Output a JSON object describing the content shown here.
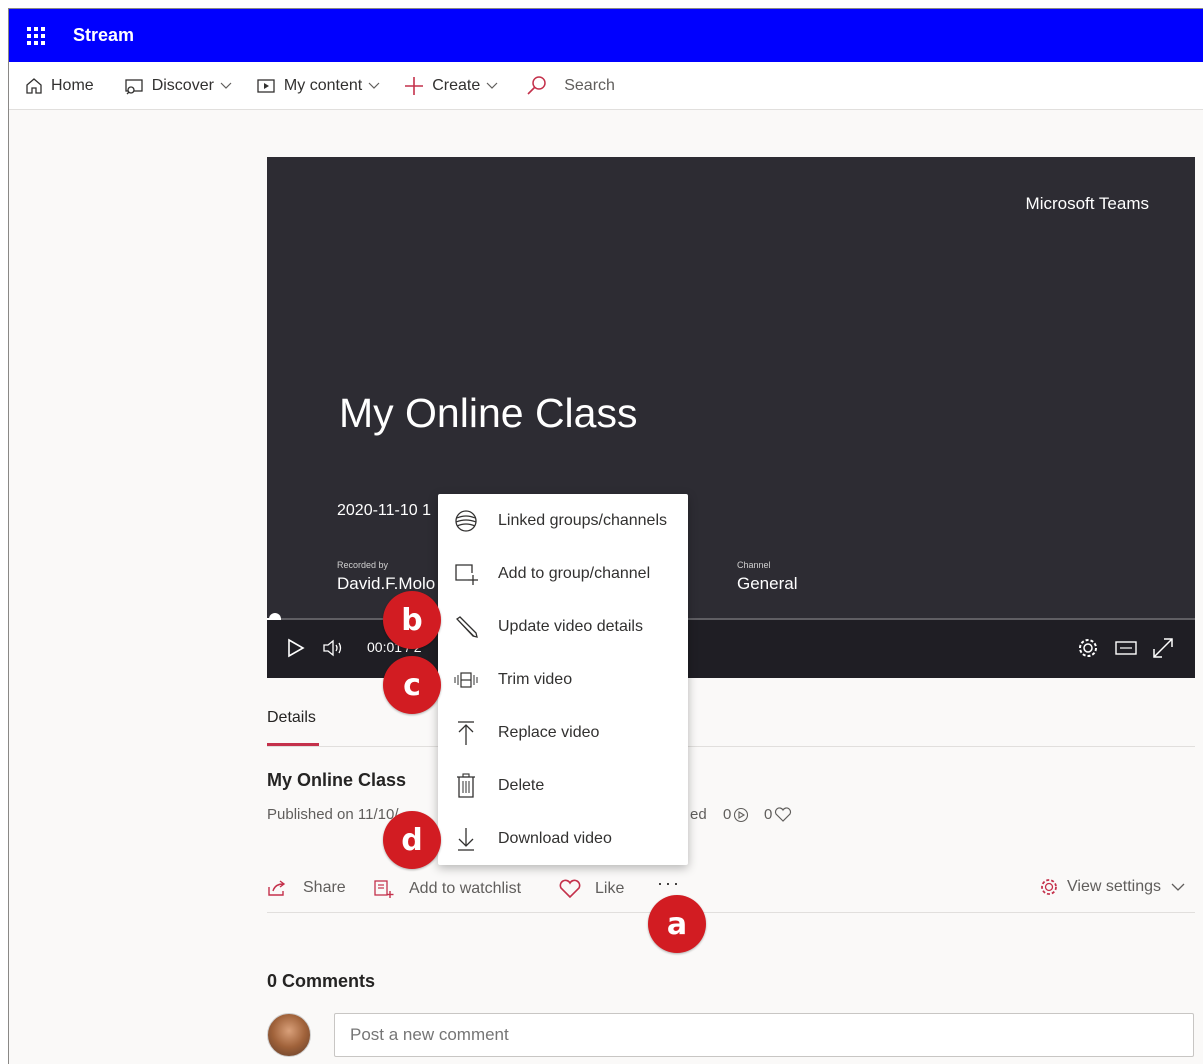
{
  "app": {
    "name": "Stream"
  },
  "nav": {
    "home": "Home",
    "discover": "Discover",
    "my_content": "My content",
    "create": "Create",
    "search": "Search"
  },
  "video": {
    "watermark": "Microsoft Teams",
    "title": "My Online Class",
    "date": "2020-11-10 1",
    "recorded_by_label": "Recorded by",
    "recorded_by": "David.F.Molo",
    "channel_label": "Channel",
    "channel": "General",
    "time": "00:01 / 2",
    "progress": 0.015
  },
  "tabs": {
    "details": "Details"
  },
  "info": {
    "title": "My Online Class",
    "published": "Published on 11/10/",
    "stat_suffix": "ed",
    "views": "0",
    "likes": "0"
  },
  "actions": {
    "share": "Share",
    "watchlist": "Add to watchlist",
    "like": "Like",
    "more": "···",
    "view_settings": "View settings"
  },
  "menu": {
    "items": [
      {
        "label": "Linked groups/channels",
        "icon": "globe-icon"
      },
      {
        "label": "Add to group/channel",
        "icon": "add-to-group-icon"
      },
      {
        "label": "Update video details",
        "icon": "pencil-icon"
      },
      {
        "label": "Trim video",
        "icon": "trim-icon"
      },
      {
        "label": "Replace video",
        "icon": "upload-icon"
      },
      {
        "label": "Delete",
        "icon": "trash-icon"
      },
      {
        "label": "Download video",
        "icon": "download-icon"
      }
    ]
  },
  "badges": {
    "a": "a",
    "b": "b",
    "c": "c",
    "d": "d"
  },
  "comments": {
    "heading": "0 Comments",
    "placeholder": "Post a new comment"
  },
  "colors": {
    "topbar": "#0000ff",
    "accent": "#c4314b",
    "badge": "#d21c22",
    "video_bg": "#2d2c33"
  }
}
